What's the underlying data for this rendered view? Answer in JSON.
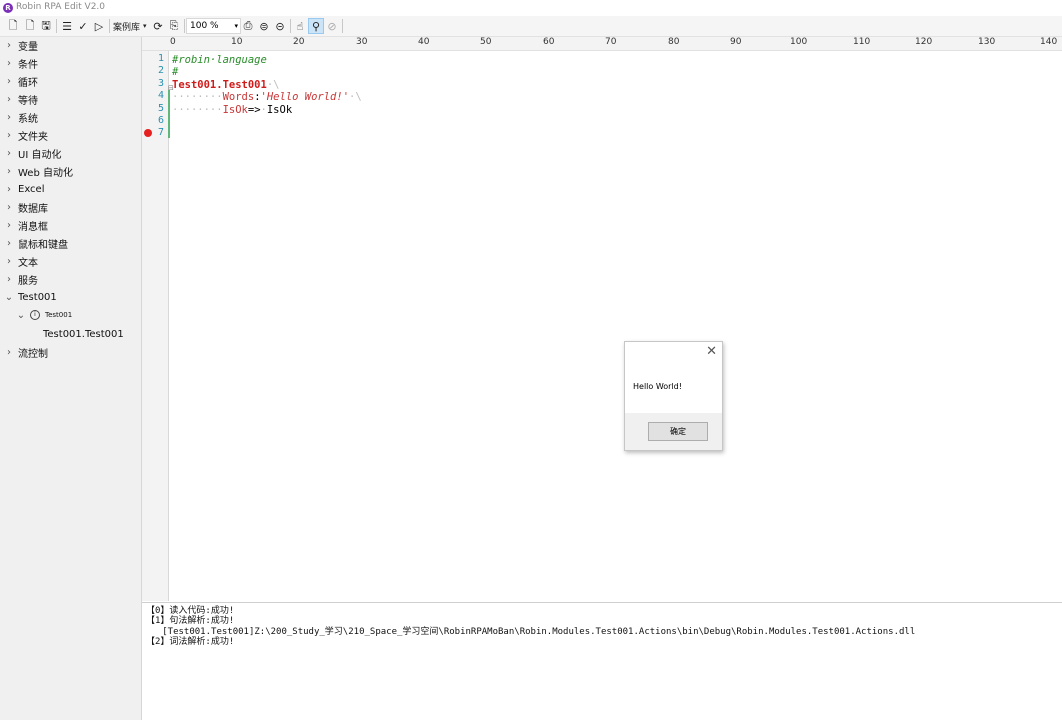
{
  "window": {
    "title": "Robin RPA Edit V2.0",
    "icon_letter": "R"
  },
  "toolbar": {
    "new_label": "🗋",
    "new2_label": "🗋",
    "save_label": "🖫",
    "list_label": "☰",
    "check_label": "✓",
    "run_label": "▷",
    "case_library_label": "案例库",
    "case_library_arrow": "▾",
    "refresh_label": "⟳",
    "export_label": "⎘",
    "zoom_value": "100 %",
    "zoom_arrow": "▾",
    "print_label": "⎙",
    "circle1_label": "⊜",
    "circle2_label": "⊝",
    "hand_label": "☝",
    "bulb_label": "⚲",
    "disabled_label": "⊘"
  },
  "sidebar": {
    "items": [
      {
        "label": "变量",
        "chev": "›"
      },
      {
        "label": "条件",
        "chev": "›"
      },
      {
        "label": "循环",
        "chev": "›"
      },
      {
        "label": "等待",
        "chev": "›"
      },
      {
        "label": "系统",
        "chev": "›"
      },
      {
        "label": "文件夹",
        "chev": "›"
      },
      {
        "label": "UI 自动化",
        "chev": "›"
      },
      {
        "label": "Web 自动化",
        "chev": "›"
      },
      {
        "label": "Excel",
        "chev": "›"
      },
      {
        "label": "数据库",
        "chev": "›"
      },
      {
        "label": "消息框",
        "chev": "›"
      },
      {
        "label": "鼠标和键盘",
        "chev": "›"
      },
      {
        "label": "文本",
        "chev": "›"
      },
      {
        "label": "服务",
        "chev": "›"
      }
    ],
    "test001": {
      "label": "Test001",
      "chev": "⌄"
    },
    "test001_sub": {
      "label": "Test001",
      "chev": "⌄",
      "info": "i"
    },
    "test001_action": {
      "label": "Test001.Test001"
    },
    "flow": {
      "label": "流控制",
      "chev": "›"
    }
  },
  "ruler": {
    "marks": [
      "0",
      "10",
      "20",
      "30",
      "40",
      "50",
      "60",
      "70",
      "80",
      "90",
      "100",
      "110",
      "120",
      "130",
      "140"
    ]
  },
  "editor": {
    "line_numbers": [
      "1",
      "2",
      "3",
      "4",
      "5",
      "6",
      "7"
    ],
    "breakpoint_line": 7,
    "line1": "#robin·language",
    "line2": "#",
    "line3_keyword": "Test001.Test001",
    "line3_rest": "·\\",
    "line4_ws": "········",
    "line4_param": "Words",
    "line4_colon": ":",
    "line4_string": "'Hello World!'",
    "line4_rest": "·\\",
    "line5_ws": "········",
    "line5_param": "IsOk",
    "line5_arrow": "=>",
    "line5_ws2": "·",
    "line5_value": "IsOk",
    "fold_marker": "⊟"
  },
  "dialog": {
    "message": "Hello World!",
    "ok_label": "确定",
    "close_label": "✕"
  },
  "output": {
    "lines": [
      "【0】读入代码:成功!",
      "【1】句法解析:成功!",
      "   [Test001.Test001]Z:\\200_Study_学习\\210_Space_学习空间\\RobinRPAMoBan\\Robin.Modules.Test001.Actions\\bin\\Debug\\Robin.Modules.Test001.Actions.dll",
      "【2】词法解析:成功!"
    ]
  },
  "colors": {
    "accent": "#7a2fb6",
    "keyword": "#d01b1b",
    "comment": "#2a8d2a",
    "line_number": "#2b91af",
    "breakpoint": "#e62020"
  }
}
